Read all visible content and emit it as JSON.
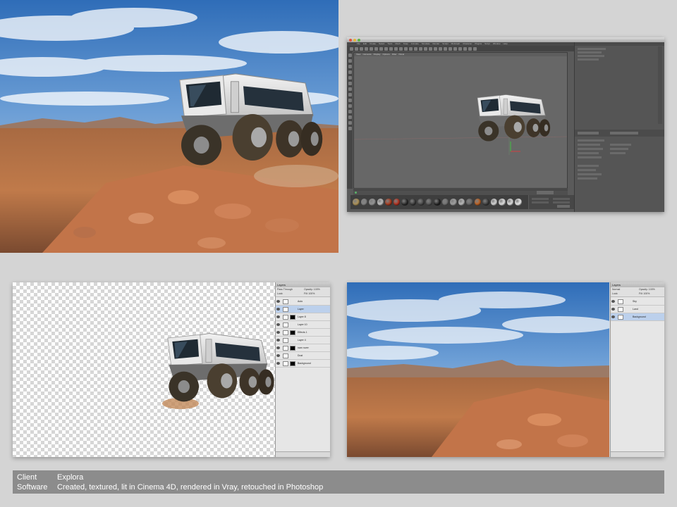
{
  "panels": {
    "render": {
      "name": "final-render"
    },
    "cinema4d": {
      "menu": [
        "File",
        "Edit",
        "Create",
        "Select",
        "Tools",
        "Mesh",
        "Snap",
        "Animate",
        "Simulate",
        "Render",
        "Sculpt",
        "MoGraph",
        "Character",
        "Plugins",
        "Script",
        "Window",
        "Help"
      ],
      "viewport_menu": [
        "View",
        "Cameras",
        "Display",
        "Options",
        "Filter",
        "Panel"
      ],
      "materials": [
        "#b89a5a",
        "#8a8a8a",
        "#9a9a9a",
        "#d0d0d0",
        "#b23a1a",
        "#c0301c",
        "#2a2a2a",
        "#3a3a3a",
        "#474747",
        "#5a5a5a",
        "#222222",
        "#777777",
        "#aaaaaa",
        "#c8c8c8",
        "#666666",
        "#c9641e",
        "#3c3c3c",
        "#e8e8e8",
        "#f2f2f2",
        "#f5f5f5",
        "#ffffff"
      ]
    },
    "photoshop_cutout": {
      "layers": [
        {
          "name": "Auto",
          "sel": false
        },
        {
          "name": "Layer",
          "sel": true
        },
        {
          "name": "Layer 8",
          "sel": false
        },
        {
          "name": "Layer 10",
          "sel": false
        },
        {
          "name": "Effects 1",
          "sel": false
        },
        {
          "name": "Layer 4",
          "sel": false
        },
        {
          "name": "nam rover",
          "sel": false
        },
        {
          "name": "Dust",
          "sel": false
        },
        {
          "name": "Background",
          "sel": false
        }
      ]
    },
    "photoshop_background": {
      "layers": [
        {
          "name": "Sky",
          "sel": false
        },
        {
          "name": "Land",
          "sel": false
        },
        {
          "name": "Background",
          "sel": true
        }
      ]
    }
  },
  "caption": {
    "client_label": "Client",
    "client_value": "Explora",
    "software_label": "Software",
    "software_value": "Created, textured, lit in Cinema 4D, rendered in Vray, retouched in Photoshop"
  }
}
